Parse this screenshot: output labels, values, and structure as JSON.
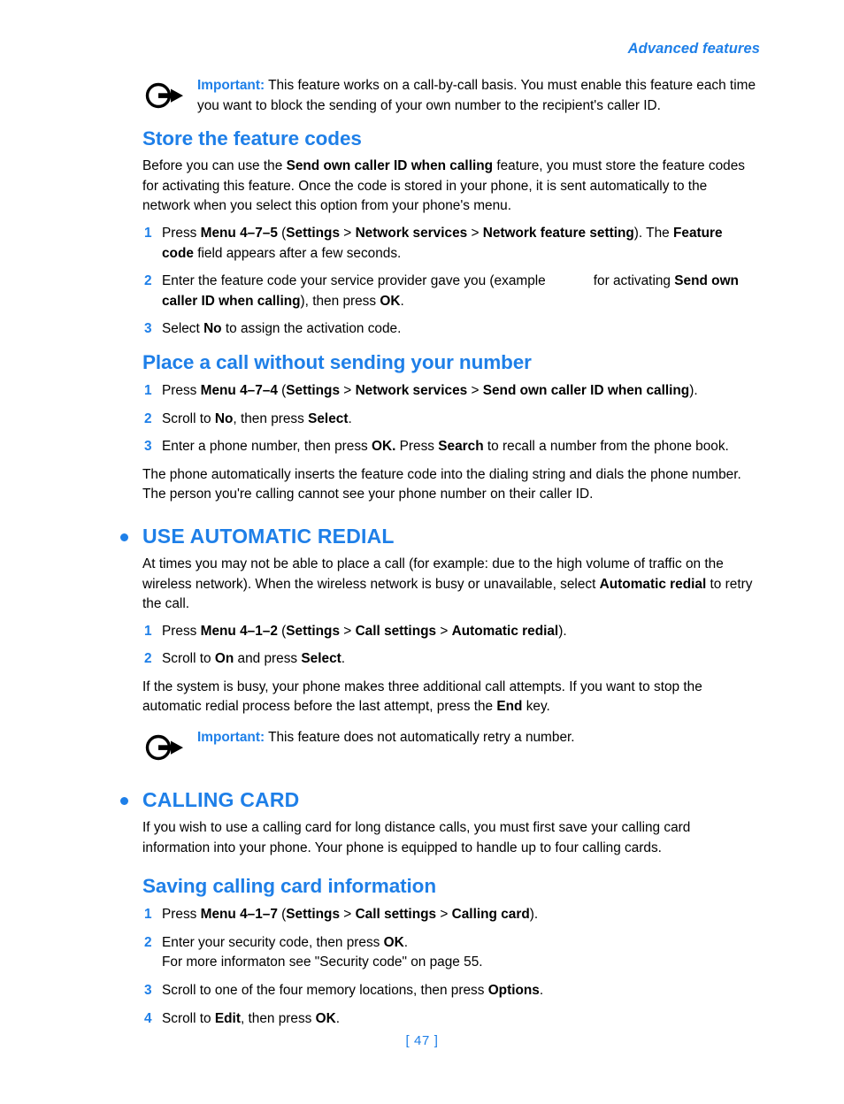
{
  "header": {
    "running_head": "Advanced features"
  },
  "notes": {
    "note1": {
      "label": "Important:",
      "text": " This feature works on a call-by-call basis. You must enable this feature each time you want to block the sending of your own number to the recipient's caller ID.",
      "icon": "circle-arrow-icon"
    },
    "note2": {
      "label": "Important:",
      "text": " This feature does not automatically retry a number.",
      "icon": "circle-arrow-icon"
    }
  },
  "sections": {
    "store_feature_codes": {
      "heading": "Store the feature codes",
      "intro": "Before you can use the ",
      "intro_bold1": "Send own caller ID when calling",
      "intro_rest": " feature, you must store the feature codes for activating this feature. Once the code is stored in your phone, it is sent automatically to the network when you select this option from your phone's menu.",
      "steps": [
        {
          "num": "1",
          "p1": "Press ",
          "b1": "Menu 4–7–5",
          "p2": " (",
          "b2": "Settings",
          "sep1": " > ",
          "b3": "Network services",
          "sep2": " > ",
          "b4": "Network feature setting",
          "p3": "). The ",
          "b5": "Feature code",
          "p4": " field appears after a few seconds."
        },
        {
          "num": "2",
          "p1": "Enter the feature code your service provider gave you (example",
          "gap": "",
          "p2": "for activating ",
          "b1": "Send own caller ID when calling",
          "p3": "), then press ",
          "b2": "OK",
          "p4": "."
        },
        {
          "num": "3",
          "p1": "Select ",
          "b1": "No",
          "p2": " to assign the activation code."
        }
      ]
    },
    "place_call_without_sending": {
      "heading": "Place a call without sending your number",
      "steps": [
        {
          "num": "1",
          "p1": "Press ",
          "b1": "Menu 4–7–4",
          "p2": " (",
          "b2": "Settings",
          "sep1": " > ",
          "b3": "Network services",
          "sep2": " > ",
          "b4": "Send own caller ID when calling",
          "p3": ")."
        },
        {
          "num": "2",
          "p1": "Scroll to ",
          "b1": "No",
          "p2": ", then press ",
          "b2": "Select",
          "p3": "."
        },
        {
          "num": "3",
          "p1": "Enter a phone number, then press ",
          "b1": "OK.",
          "p2": " Press ",
          "b2": "Search",
          "p3": " to recall a number from the phone book."
        }
      ],
      "outro": "The phone automatically inserts the feature code into the dialing string and dials the phone number. The person you're calling cannot see your phone number on their caller ID."
    },
    "use_automatic_redial": {
      "heading": "USE AUTOMATIC REDIAL",
      "intro_p1": "At times you may not be able to place a call (for example: due to the high volume of traffic on the wireless network). When the wireless network is busy or unavailable, select ",
      "intro_b1": "Automatic redial",
      "intro_p2": " to retry the call.",
      "steps": [
        {
          "num": "1",
          "p1": "Press ",
          "b1": "Menu 4–1–2",
          "p2": " (",
          "b2": "Settings",
          "sep1": " > ",
          "b3": "Call settings",
          "sep2": " > ",
          "b4": "Automatic redial",
          "p3": ")."
        },
        {
          "num": "2",
          "p1": "Scroll to ",
          "b1": "On",
          "p2": " and press ",
          "b2": "Select",
          "p3": "."
        }
      ],
      "outro_p1": "If the system is busy, your phone makes three additional call attempts. If you want to stop the automatic redial process before the last attempt, press the ",
      "outro_b1": "End",
      "outro_p2": " key."
    },
    "calling_card": {
      "heading": "CALLING CARD",
      "intro": "If you wish to use a calling card for long distance calls, you must first save your calling card information into your phone. Your phone is equipped to handle up to four calling cards."
    },
    "saving_calling_card_information": {
      "heading": "Saving calling card information",
      "steps": [
        {
          "num": "1",
          "p1": "Press ",
          "b1": "Menu 4–1–7",
          "p2": " (",
          "b2": "Settings",
          "sep1": " > ",
          "b3": "Call settings",
          "sep2": " > ",
          "b4": "Calling card",
          "p3": ")."
        },
        {
          "num": "2",
          "p1": "Enter your security code, then press ",
          "b1": "OK",
          "p2": ".",
          "line2": "For more informaton see \"Security code\" on page 55."
        },
        {
          "num": "3",
          "p1": "Scroll to one of the four memory locations, then press ",
          "b1": "Options",
          "p2": "."
        },
        {
          "num": "4",
          "p1": "Scroll to ",
          "b1": "Edit",
          "p2": ", then press ",
          "b2": "OK",
          "p3": "."
        }
      ]
    }
  },
  "footer": {
    "page_number": "[ 47 ]"
  },
  "colors": {
    "accent_blue": "#1E7FE8",
    "body_black": "#000000"
  }
}
